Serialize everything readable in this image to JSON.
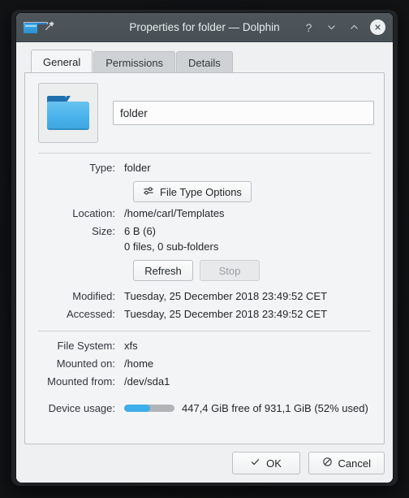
{
  "titlebar": {
    "title": "Properties for folder — Dolphin",
    "app_icon": "folder-icon",
    "pin_icon": "pin-icon",
    "help_label": "?",
    "minimize_icon": "chevron-down-icon",
    "maximize_icon": "chevron-up-icon",
    "close_icon": "close-icon"
  },
  "tabs": [
    {
      "label": "General",
      "active": true
    },
    {
      "label": "Permissions",
      "active": false
    },
    {
      "label": "Details",
      "active": false
    }
  ],
  "general": {
    "icon_name": "folder-icon",
    "name_value": "folder",
    "name_placeholder": "",
    "rows": {
      "type_label": "Type:",
      "type_value": "folder",
      "file_type_options_label": "File Type Options",
      "file_type_options_icon": "sliders-icon",
      "location_label": "Location:",
      "location_value": "/home/carl/Templates",
      "size_label": "Size:",
      "size_value": "6 B (6)",
      "size_detail": "0 files, 0 sub-folders",
      "refresh_label": "Refresh",
      "stop_label": "Stop",
      "modified_label": "Modified:",
      "modified_value": "Tuesday, 25 December 2018 23:49:52 CET",
      "accessed_label": "Accessed:",
      "accessed_value": "Tuesday, 25 December 2018 23:49:52 CET",
      "filesystem_label": "File System:",
      "filesystem_value": "xfs",
      "mounted_on_label": "Mounted on:",
      "mounted_on_value": "/home",
      "mounted_from_label": "Mounted from:",
      "mounted_from_value": "/dev/sda1",
      "device_usage_label": "Device usage:",
      "device_usage_value": "447,4 GiB free of 931,1 GiB (52% used)",
      "device_usage_percent": 52
    }
  },
  "footer": {
    "ok_label": "OK",
    "ok_icon": "check-icon",
    "cancel_label": "Cancel",
    "cancel_icon": "cancel-icon"
  },
  "colors": {
    "accent": "#3daee9",
    "titlebar": "#4b545a",
    "window_bg": "#eff0f1"
  }
}
